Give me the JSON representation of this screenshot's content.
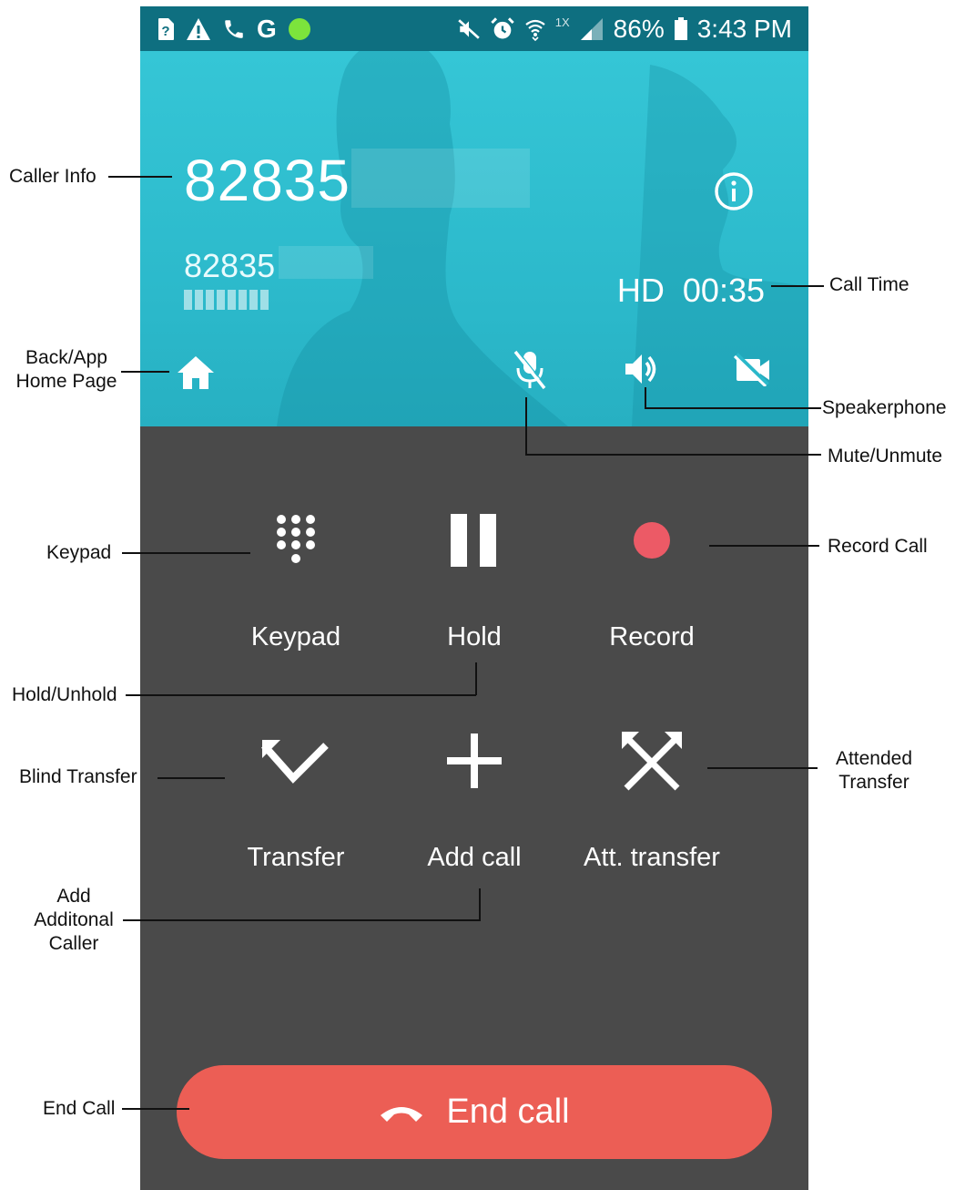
{
  "status_bar": {
    "battery": "86%",
    "time": "3:43 PM",
    "network_small": "1X",
    "carrier_icon": "G",
    "icons_left": [
      "sim-unknown-icon",
      "warning-icon",
      "phone-icon",
      "google-icon",
      "green-dot-icon"
    ],
    "icons_right": [
      "mute-notifications-icon",
      "alarm-icon",
      "wifi-icon",
      "signal-icon",
      "battery-icon"
    ]
  },
  "caller": {
    "name": "82835",
    "number": "82835",
    "hd": "HD",
    "duration": "00:35"
  },
  "controls": {
    "home_icon": "home-icon",
    "mute_icon": "mic-off-icon",
    "speaker_icon": "speaker-icon",
    "video_icon": "video-off-icon",
    "info_icon": "info-icon"
  },
  "actions": [
    {
      "label": "Keypad",
      "icon": "keypad-icon"
    },
    {
      "label": "Hold",
      "icon": "pause-icon"
    },
    {
      "label": "Record",
      "icon": "record-icon"
    },
    {
      "label": "Transfer",
      "icon": "transfer-icon"
    },
    {
      "label": "Add call",
      "icon": "add-icon"
    },
    {
      "label": "Att. transfer",
      "icon": "attended-transfer-icon"
    }
  ],
  "end_call": {
    "label": "End call",
    "icon": "hangup-icon"
  },
  "annotations": {
    "caller_info": "Caller Info",
    "call_time": "Call Time",
    "back_app": "Back/App",
    "home_page": "Home Page",
    "speakerphone": "Speakerphone",
    "mute_unmute": "Mute/Unmute",
    "keypad": "Keypad",
    "record_call": "Record Call",
    "hold_unhold": "Hold/Unhold",
    "blind_transfer": "Blind Transfer",
    "attended": "Attended",
    "transfer": "Transfer",
    "add": "Add",
    "additonal": "Additonal",
    "caller": "Caller",
    "end_call": "End Call"
  },
  "colors": {
    "status_bar": "#0e6f80",
    "call_card": "#35c6d6",
    "panel": "#4a4a4a",
    "record": "#ec5a66",
    "end_call": "#ec5e55",
    "green_dot": "#7ce43c"
  }
}
